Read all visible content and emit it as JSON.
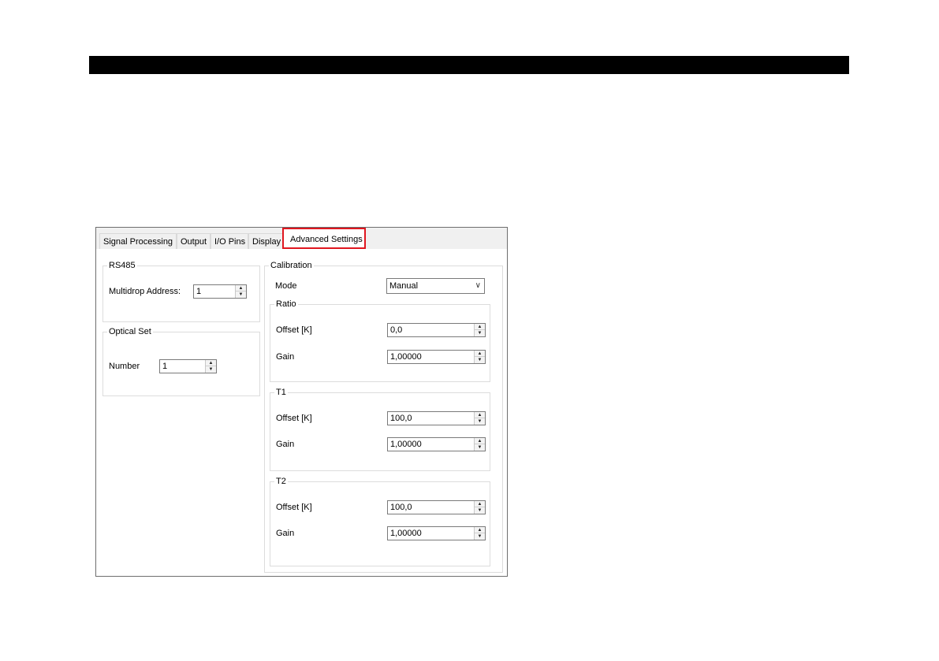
{
  "tabs": [
    {
      "label": "Signal Processing"
    },
    {
      "label": "Output"
    },
    {
      "label": "I/O Pins"
    },
    {
      "label": "Display"
    },
    {
      "label": "Advanced Settings",
      "active": true
    }
  ],
  "rs485": {
    "title": "RS485",
    "address_label": "Multidrop Address:",
    "address_value": "1"
  },
  "optical": {
    "title": "Optical Set",
    "number_label": "Number",
    "number_value": "1"
  },
  "calibration": {
    "title": "Calibration",
    "mode_label": "Mode",
    "mode_value": "Manual",
    "ratio": {
      "title": "Ratio",
      "offset_label": "Offset [K]",
      "offset_value": "0,0",
      "gain_label": "Gain",
      "gain_value": "1,00000"
    },
    "t1": {
      "title": "T1",
      "offset_label": "Offset [K]",
      "offset_value": "100,0",
      "gain_label": "Gain",
      "gain_value": "1,00000"
    },
    "t2": {
      "title": "T2",
      "offset_label": "Offset [K]",
      "offset_value": "100,0",
      "gain_label": "Gain",
      "gain_value": "1,00000"
    }
  },
  "colors": {
    "highlight": "#e0161f",
    "top_bar": "#000000"
  }
}
